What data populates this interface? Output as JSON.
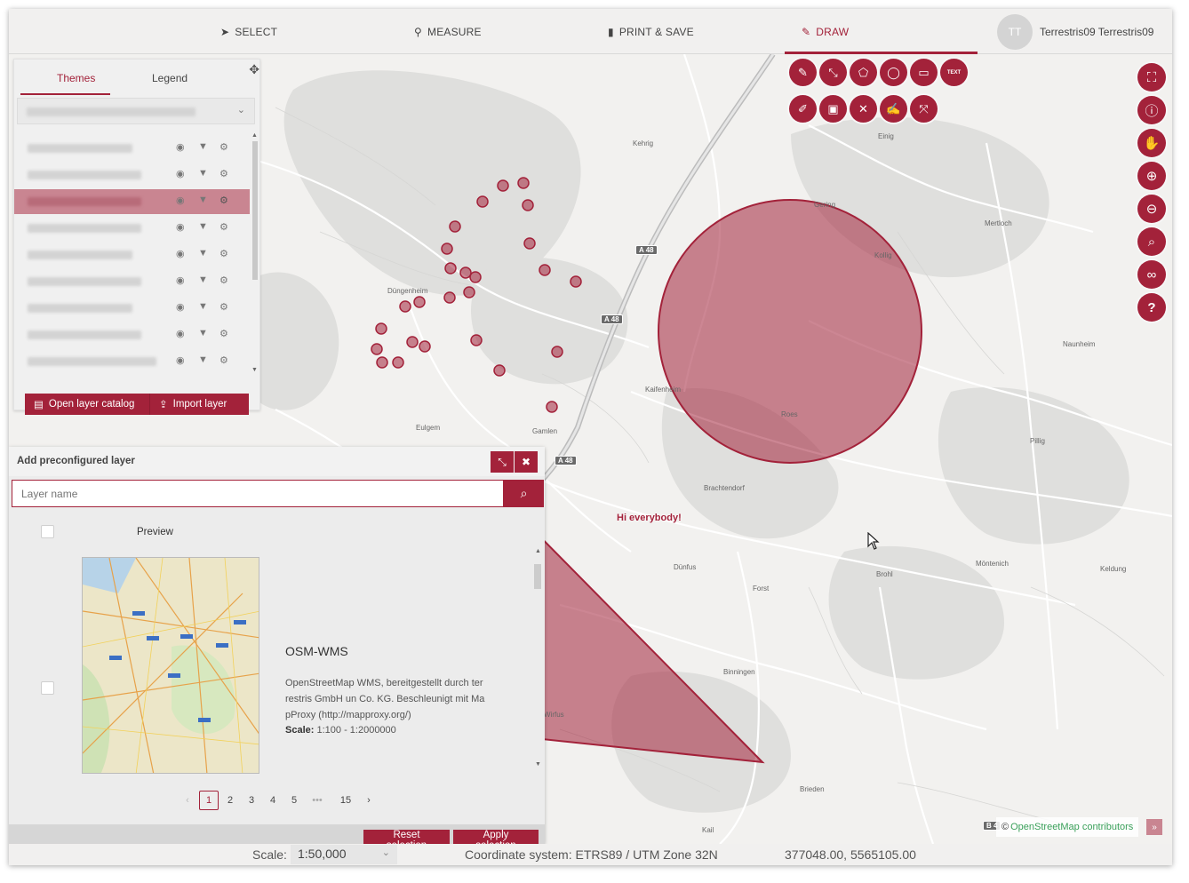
{
  "topbar": {
    "nav": [
      {
        "label": "SELECT",
        "icon": "pointer-icon"
      },
      {
        "label": "MEASURE",
        "icon": "map-marker-icon"
      },
      {
        "label": "PRINT & SAVE",
        "icon": "document-icon"
      },
      {
        "label": "DRAW",
        "icon": "brush-icon",
        "active": true
      }
    ],
    "user": {
      "initials": "TT",
      "name": "Terrestris09 Terrestris09"
    }
  },
  "themes_panel": {
    "tabs": [
      {
        "label": "Themes",
        "active": true
      },
      {
        "label": "Legend"
      }
    ],
    "actions": {
      "catalog": "Open layer catalog",
      "import": "Import layer"
    }
  },
  "add_layer_dialog": {
    "title": "Add preconfigured layer",
    "search_placeholder": "Layer name",
    "column_preview": "Preview",
    "item": {
      "title": "OSM-WMS",
      "description": "OpenStreetMap WMS, bereitgestellt durch ter restris GmbH un Co. KG. Beschleunigt mit Ma pProxy (http://mapproxy.org/)",
      "scale_label": "Scale:",
      "scale_value": "1:100 - 1:2000000"
    },
    "pagination": {
      "pages": [
        "1",
        "2",
        "3",
        "4",
        "5",
        "•••",
        "15"
      ],
      "current": "1"
    },
    "buttons": {
      "reset": "Reset selection",
      "apply": "Apply selection"
    }
  },
  "map": {
    "annotation_text": "Hi everybody!",
    "places": [
      "Kehrig",
      "Einig",
      "Mertloch",
      "Kollig",
      "Naunheim",
      "Düngenheim",
      "Kaifenheim",
      "Roes",
      "Pillig",
      "Eulgem",
      "Gamlen",
      "Brachtendorf",
      "Dünfus",
      "Forst",
      "Brohl",
      "Möntenich",
      "Keldung",
      "Binningen",
      "Wirfus",
      "Brieden",
      "Kail",
      "Gering"
    ],
    "roads": [
      "A 48",
      "A 48",
      "A 48",
      "B 4"
    ],
    "attribution_prefix": "©",
    "attribution_link": "OpenStreetMap contributors",
    "accent_color": "#a3223a"
  },
  "statusbar": {
    "scale_label": "Scale:",
    "scale_value": "1:50,000",
    "crs": "Coordinate system: ETRS89 / UTM Zone 32N",
    "coordinates": "377048.00, 5565105.00"
  },
  "draw_tools": [
    "draw-point-icon",
    "draw-line-icon",
    "draw-polygon-icon",
    "draw-circle-icon",
    "draw-rectangle-icon",
    "draw-text-icon",
    "edit-icon",
    "select-box-icon",
    "delete-icon",
    "style-icon",
    "move-icon"
  ],
  "draw_text_label": "TEXT",
  "map_tools": [
    "zoom-extent-icon",
    "info-icon",
    "pan-icon",
    "zoom-in-icon",
    "zoom-out-icon",
    "zoom-box-icon",
    "binoculars-icon",
    "help-icon"
  ]
}
